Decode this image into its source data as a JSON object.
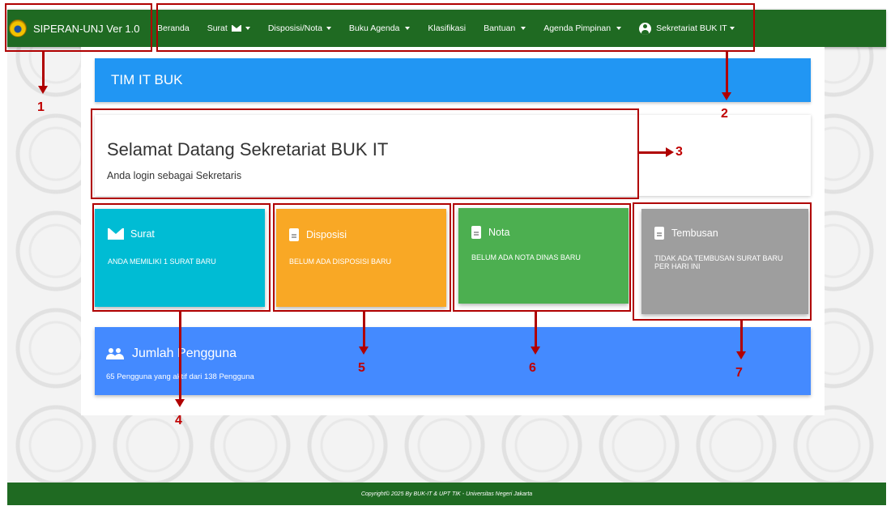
{
  "brand": {
    "title": "SIPERAN-UNJ Ver 1.0"
  },
  "nav": {
    "items": [
      {
        "label": "Beranda",
        "dropdown": false
      },
      {
        "label": "Surat",
        "dropdown": true,
        "icon": "mail-icon"
      },
      {
        "label": "Disposisi/Nota",
        "dropdown": true
      },
      {
        "label": "Buku Agenda",
        "dropdown": true
      },
      {
        "label": "Klasifikasi",
        "dropdown": false
      },
      {
        "label": "Bantuan",
        "dropdown": true
      },
      {
        "label": "Agenda Pimpinan",
        "dropdown": true
      }
    ],
    "user": {
      "label": "Sekretariat BUK IT",
      "icon": "user-circle-icon"
    }
  },
  "header": {
    "title": "TIM IT BUK"
  },
  "welcome": {
    "title": "Selamat Datang Sekretariat BUK IT",
    "subtitle": "Anda login sebagai Sekretaris"
  },
  "cards": [
    {
      "title": "Surat",
      "message": "ANDA MEMILIKI 1 SURAT BARU",
      "color": "#00bcd4",
      "icon": "mail-icon"
    },
    {
      "title": "Disposisi",
      "message": "BELUM ADA DISPOSISI BARU",
      "color": "#f9a825",
      "icon": "document-icon"
    },
    {
      "title": "Nota",
      "message": "BELUM ADA NOTA DINAS BARU",
      "color": "#4caf50",
      "icon": "document-icon"
    },
    {
      "title": "Tembusan",
      "message": "TIDAK ADA TEMBUSAN SURAT BARU PER HARI INI",
      "color": "#9e9e9e",
      "icon": "document-icon"
    }
  ],
  "users": {
    "title": "Jumlah Pengguna",
    "message": "65 Pengguna yang aktif dari 138 Pengguna",
    "icon": "users-icon"
  },
  "footer": {
    "copyright": "Copyright",
    "text": " © 2025 By BUK-IT & UPT TIK - Universitas Negeri Jakarta"
  },
  "annotations": [
    "1",
    "2",
    "3",
    "4",
    "5",
    "6",
    "7"
  ],
  "colors": {
    "navbar": "#1f6a22",
    "header": "#2196f3",
    "users_card": "#448aff",
    "annotation": "#b00000"
  }
}
